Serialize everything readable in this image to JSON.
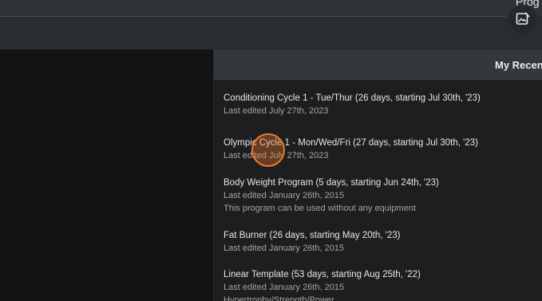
{
  "header": {
    "cut_text": "Prog",
    "image_button_icon": "image-edit-icon"
  },
  "panel": {
    "title": "My Recent",
    "programs": [
      {
        "title": "Conditioning Cycle 1 - Tue/Thur (26 days, starting Jul 30th, '23)",
        "edited": "Last edited July 27th, 2023"
      },
      {
        "title": "Olympic Cycle 1 - Mon/Wed/Fri (27 days, starting Jul 30th, '23)",
        "edited": "Last edited July 27th, 2023"
      },
      {
        "title": "Body Weight Program (5 days, starting Jun 24th, '23)",
        "edited": "Last edited January 26th, 2015",
        "description": "This program can be used without any equipment"
      },
      {
        "title": "Fat Burner (26 days, starting May 20th, '23)",
        "edited": "Last edited January 26th, 2015"
      },
      {
        "title": "Linear Template (53 days, starting Aug 25th, '22)",
        "edited": "Last edited January 26th, 2015",
        "description": "Hypertrophy/Strength/Power"
      }
    ]
  },
  "colors": {
    "background": "#131313",
    "panel": "#1d1e20",
    "panel_header": "#34373b",
    "top_bar": "#2a2d30",
    "cursor_accent": "#f07a2b"
  }
}
